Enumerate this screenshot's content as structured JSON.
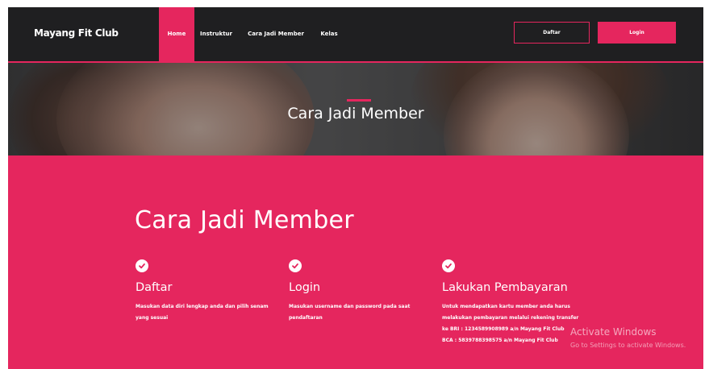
{
  "navbar": {
    "brand": "Mayang Fit Club",
    "links": [
      "Home",
      "Instruktur",
      "Cara Jadi Member",
      "Kelas"
    ],
    "register_label": "Daftar",
    "login_label": "Login"
  },
  "hero": {
    "title": "Cara Jadi Member"
  },
  "section": {
    "title": "Cara Jadi Member",
    "steps": [
      {
        "title": "Daftar",
        "lines": [
          "Masukan data diri lengkap anda dan pilih senam",
          "yang sesuai"
        ]
      },
      {
        "title": "Login",
        "lines": [
          "Masukan username dan password pada saat",
          "pendaftaran"
        ]
      },
      {
        "title": "Lakukan Pembayaran",
        "lines": [
          "Untuk mendapatkan kartu member anda harus",
          "melakukan pembayaran melalui rekening transfer",
          "ke BRI : 1234589908989 a/n Mayang Fit Club",
          "BCA : 5839788398575 a/n Mayang Fit Club"
        ]
      }
    ]
  },
  "overlay": {
    "title": "Activate Windows",
    "subtitle": "Go to Settings to activate Windows."
  },
  "colors": {
    "accent": "#e5265e",
    "navbar_bg": "#1f1f21"
  }
}
